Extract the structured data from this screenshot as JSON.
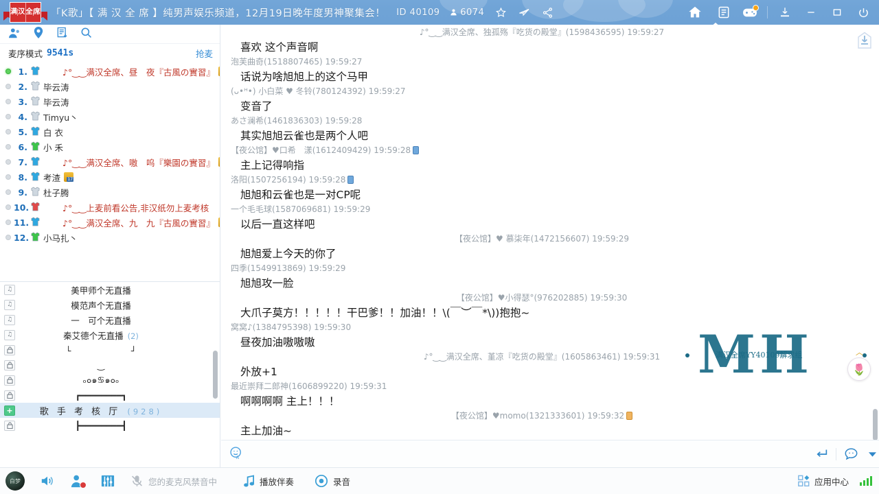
{
  "titlebar": {
    "logo_chars": [
      "满",
      "全",
      "汉",
      "席"
    ],
    "room_title": "「K歌」【 满 汉 全 席 】纯男声娱乐频道，12月19日晚年度男神聚集会！",
    "id_label": "ID 40109",
    "user_count": "6074",
    "icons": [
      "star-icon",
      "paper-plane-icon",
      "share-icon"
    ],
    "right_buttons": [
      "home-icon",
      "list-icon",
      "game-icon",
      "download-icon",
      "minimize-icon",
      "maximize-icon",
      "power-icon"
    ]
  },
  "left_panel": {
    "toolbar_icons": [
      "members-icon",
      "location-icon",
      "seat-list-icon",
      "search-icon"
    ],
    "mic_mode_label": "麦序模式",
    "mic_timer": "9541s",
    "grab_mic_label": "抢麦",
    "seats": [
      {
        "num": "1.",
        "name": "♪°‿‿满汉全席、昼　夜『古風の實習』",
        "red": true,
        "shirt": "#2fa8e0",
        "active": true,
        "level": "20"
      },
      {
        "num": "2.",
        "name": "毕云涛",
        "red": false,
        "shirt": "#cfd8e0",
        "active": false,
        "level": ""
      },
      {
        "num": "3.",
        "name": "毕云涛",
        "red": false,
        "shirt": "#cfd8e0",
        "active": false,
        "level": ""
      },
      {
        "num": "4.",
        "name": "Timyu丶",
        "red": false,
        "shirt": "#cfd8e0",
        "active": false,
        "level": ""
      },
      {
        "num": "5.",
        "name": "白 衣",
        "red": false,
        "shirt": "#2fa8e0",
        "active": false,
        "level": ""
      },
      {
        "num": "6.",
        "name": "小 禾",
        "red": false,
        "shirt": "#3dc44a",
        "active": false,
        "level": ""
      },
      {
        "num": "7.",
        "name": "♪°‿‿满汉全席、嗷　呜『樂園の實習』",
        "red": true,
        "shirt": "#2fa8e0",
        "active": false,
        "level": "16"
      },
      {
        "num": "8.",
        "name": "考渣",
        "red": false,
        "shirt": "#2fa8e0",
        "active": false,
        "level": "17"
      },
      {
        "num": "9.",
        "name": "杜子腾",
        "red": false,
        "shirt": "#cfd8e0",
        "active": false,
        "level": ""
      },
      {
        "num": "10.",
        "name": "♪°‿‿上麦前看公告,非汉纸勿上麦考核",
        "red": true,
        "shirt": "#e04b4b",
        "active": false,
        "level": ""
      },
      {
        "num": "11.",
        "name": "♪°‿‿满汉全席、九　九『古風の實習』",
        "red": true,
        "shirt": "#2fa8e0",
        "active": false,
        "level": "15"
      },
      {
        "num": "12.",
        "name": "小马扎丶",
        "red": false,
        "shirt": "#3dc44a",
        "active": false,
        "level": ""
      }
    ],
    "channels": [
      {
        "icon": "music-note-icon",
        "text": "美甲师个无直播",
        "count": "",
        "selected": false
      },
      {
        "icon": "music-note-icon",
        "text": "模范声个无直播",
        "count": "",
        "selected": false
      },
      {
        "icon": "music-note-icon",
        "text": "一　可个无直播",
        "count": "",
        "selected": false
      },
      {
        "icon": "music-note-icon",
        "text": "秦艾德个无直播",
        "count": "(2)",
        "selected": false
      },
      {
        "icon": "lock-icon",
        "text": "└　　　　　　　┘",
        "count": "",
        "selected": false
      },
      {
        "icon": "lock-icon",
        "text": "‿",
        "count": "",
        "selected": false
      },
      {
        "icon": "lock-icon",
        "text": "ₒ๐๑♋๑๐ₒ",
        "count": "",
        "selected": false
      },
      {
        "icon": "lock-icon",
        "text": "┏━━━━━━━━┓",
        "count": "",
        "selected": false
      },
      {
        "icon": "plus-icon",
        "text": "歌 手 考 核 厅",
        "count": "(928)",
        "selected": true
      },
      {
        "icon": "lock-icon",
        "text": "┣━━━━━━━━┫",
        "count": "",
        "selected": false
      }
    ]
  },
  "chat": {
    "messages": [
      {
        "head": "♪°‿‿满汉全席、独孤殇『吃货の殿堂』(1598436595) 19:59:27",
        "align": "center",
        "phone": "",
        "body": "喜欢 这个声音啊"
      },
      {
        "head": "泡芙曲奇(1518807465) 19:59:27",
        "align": "left",
        "phone": "",
        "body": "话说为啥旭旭上的这个马甲"
      },
      {
        "head": "(ᴗ•ᴴ•) 小白菜 ♥ 冬铃(780124392) 19:59:27",
        "align": "left",
        "phone": "",
        "body": "变音了"
      },
      {
        "head": "あさ澜希(1461836303) 19:59:28",
        "align": "left",
        "phone": "",
        "body": "其实旭旭云雀也是两个人吧"
      },
      {
        "head": "【夜公馆】♥口希　漾(1612409429) 19:59:28",
        "align": "left",
        "phone": "blue",
        "body": "主上记得响指"
      },
      {
        "head": "洛阳(1507256194) 19:59:28",
        "align": "left",
        "phone": "blue",
        "body": "旭旭和云雀也是一对CP呢"
      },
      {
        "head": "一个毛毛球(1587069681) 19:59:29",
        "align": "left",
        "phone": "",
        "body": "以后一直这样吧"
      },
      {
        "head": "【夜公馆】♥ 慕柒年(1472156607) 19:59:29",
        "align": "center",
        "phone": "",
        "body": "旭旭爱上今天的你了"
      },
      {
        "head": "四季(1549913869) 19:59:29",
        "align": "left",
        "phone": "",
        "body": "旭旭攻一脸"
      },
      {
        "head": "【夜公馆】♥小得瑟°(976202885) 19:59:30",
        "align": "center",
        "phone": "",
        "body": "大爪子莫方！！！！！干巴爹！！加油！！\\(￣︶￣*\\))抱抱~"
      },
      {
        "head": "窝窝♪(1384795398) 19:59:30",
        "align": "left",
        "phone": "",
        "body": "昼夜加油嗷嗷嗷"
      },
      {
        "head": "♪°‿‿满汉全席、堇凉『吃货の殿堂』(1605863461) 19:59:31",
        "align": "center",
        "phone": "",
        "body": "外放+1"
      },
      {
        "head": "最近崇拜二郎神(1606899220) 19:59:31",
        "align": "left",
        "phone": "",
        "body": "啊啊啊啊 主上！！！"
      },
      {
        "head": "【夜公馆】♥momo(1321333601) 19:59:32",
        "align": "center",
        "phone": "orange",
        "body": "主上加油~"
      }
    ],
    "input_placeholder": "",
    "emoji_icon": "emoji-icon",
    "send_icon": "enter-icon",
    "chat_mode_icon": "speech-bubble-icon"
  },
  "watermark": {
    "big_text": "MH",
    "sub_text": "满汉全席YY40109解求组"
  },
  "flower": {
    "icon": "tulip-icon"
  },
  "bottom": {
    "speaker_icon": "speaker-icon",
    "add_user_icon": "add-user-icon",
    "equalizer_icon": "equalizer-icon",
    "mic_muted_icon": "mic-muted-icon",
    "mic_status": "您的麦克风禁音中",
    "accompaniment_icon": "music-note-icon",
    "accompaniment_label": "播放伴奏",
    "record_icon": "record-icon",
    "record_label": "录音",
    "appcenter_icon": "grid-icon",
    "appcenter_label": "应用中心",
    "signal_icon": "signal-bars-icon"
  },
  "colors": {
    "title_bg": "#6ea2d5",
    "accent_blue": "#3a8fd6",
    "seat_num": "#1f6fb8",
    "red_name": "#c0392b",
    "selected_channel": "#dceaf7",
    "watermark": "#1b6b86"
  }
}
